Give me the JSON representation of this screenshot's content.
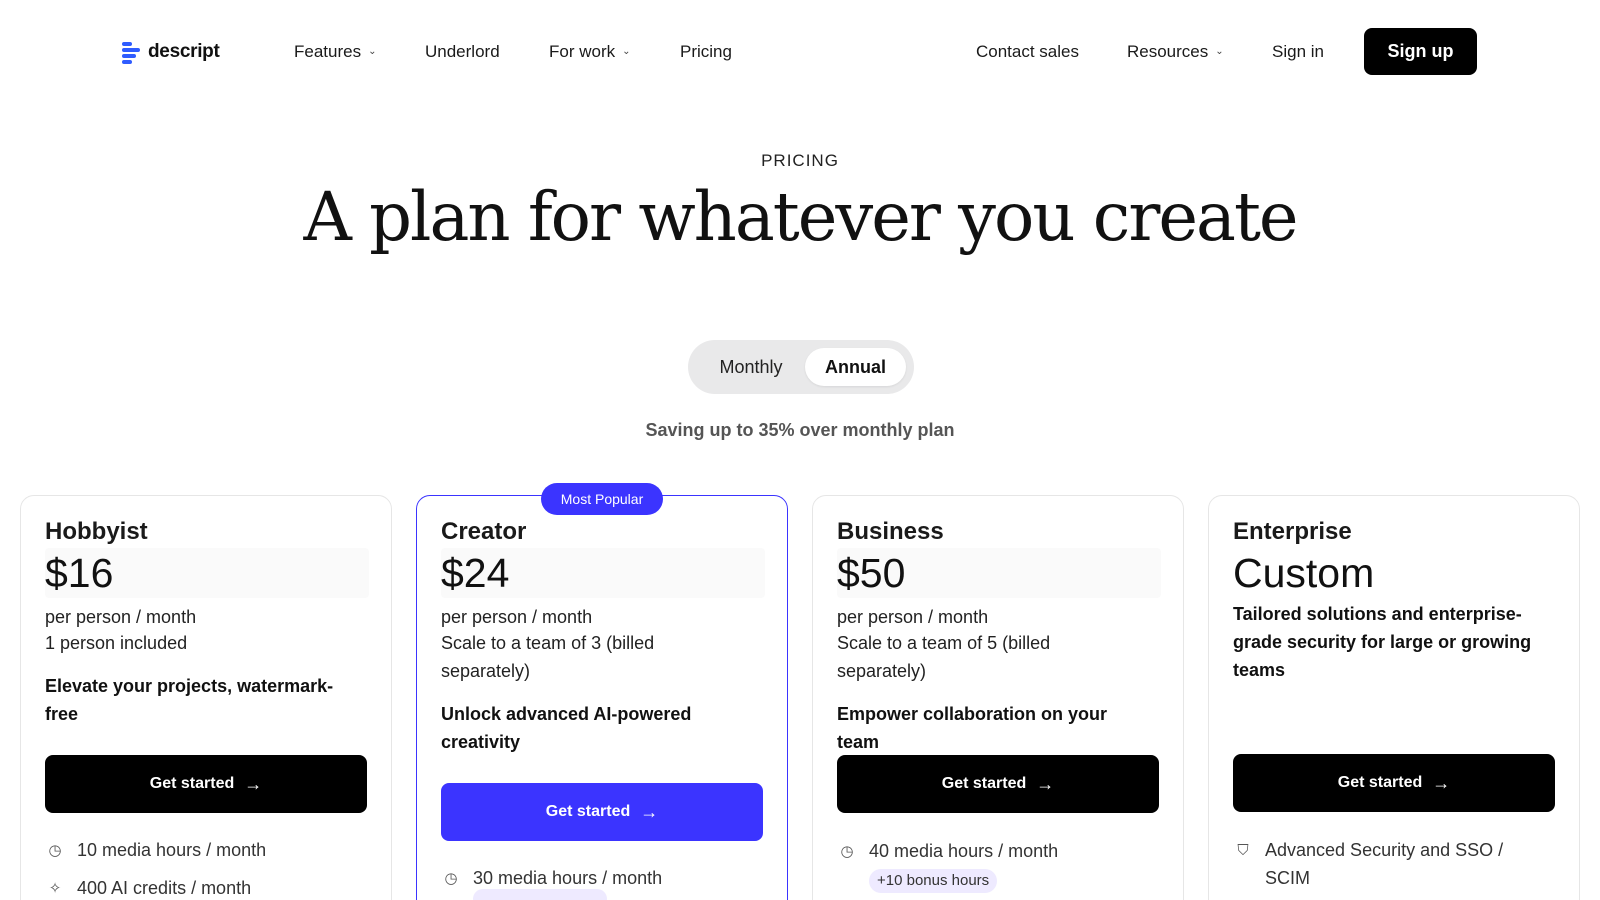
{
  "nav": {
    "logo_text": "descript",
    "items": [
      {
        "label": "Features",
        "chevron": true
      },
      {
        "label": "Underlord",
        "chevron": false
      },
      {
        "label": "For work",
        "chevron": true
      },
      {
        "label": "Pricing",
        "chevron": false
      }
    ],
    "right": [
      {
        "label": "Contact sales",
        "chevron": false
      },
      {
        "label": "Resources",
        "chevron": true
      },
      {
        "label": "Sign in",
        "chevron": false
      }
    ],
    "signup_label": "Sign up",
    "chevron_glyph": "⌄"
  },
  "hero": {
    "eyebrow": "PRICING",
    "headline": "A plan for whatever you create",
    "toggle": {
      "monthly": "Monthly",
      "annual": "Annual",
      "selected": "Annual"
    },
    "saving": "Saving up to 35% over monthly plan"
  },
  "plans": [
    {
      "name": "Hobbyist",
      "price": "$16",
      "per": "per person / month",
      "scale": "1 person included",
      "tagline": "Elevate your projects, watermark-free",
      "cta": "Get started",
      "features": [
        {
          "icon": "clock-icon",
          "text": "10 media hours / month"
        },
        {
          "icon": "sparkle-icon",
          "text": "400 AI credits / month"
        }
      ]
    },
    {
      "name": "Creator",
      "badge": "Most Popular",
      "price": "$24",
      "per": "per person / month",
      "scale": "Scale to a team of 3 (billed separately)",
      "tagline": "Unlock advanced AI-powered creativity",
      "cta": "Get started",
      "features": [
        {
          "icon": "clock-icon",
          "text": "30 media hours / month"
        }
      ]
    },
    {
      "name": "Business",
      "price": "$50",
      "per": "per person / month",
      "scale": "Scale to a team of 5 (billed separately)",
      "tagline": "Empower collaboration on your team",
      "cta": "Get started",
      "features": [
        {
          "icon": "clock-icon",
          "text": "40 media hours / month",
          "bonus": "+10 bonus hours"
        }
      ]
    },
    {
      "name": "Enterprise",
      "price": "Custom",
      "tagline": "Tailored solutions and enterprise-grade security for large or growing teams",
      "cta": "Get started",
      "features": [
        {
          "icon": "shield-icon",
          "text": "Advanced Security and SSO / SCIM"
        }
      ]
    }
  ],
  "colors": {
    "accent": "#3b34ff",
    "logo_blue": "#2f5cff",
    "primary_button": "#000000"
  },
  "icons": {
    "arrow": "→",
    "clock-icon": "◷",
    "sparkle-icon": "✧",
    "shield-icon": "⛉"
  }
}
